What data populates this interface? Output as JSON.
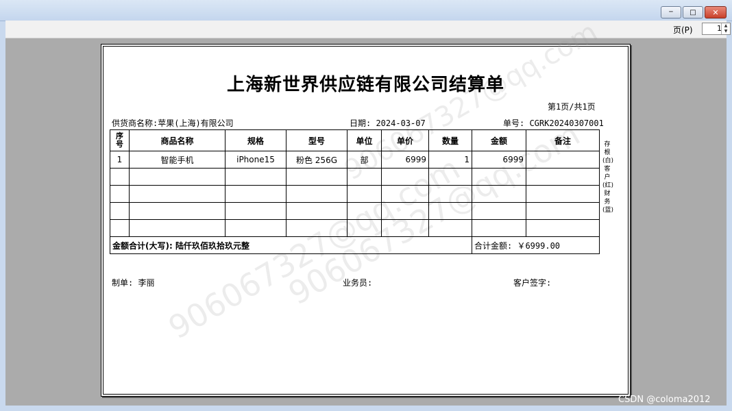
{
  "window": {
    "minimize": "─",
    "maximize": "□",
    "close": "✕"
  },
  "toolbar": {
    "page_label": "页(P)",
    "page_value": "1"
  },
  "doc": {
    "title": "上海新世界供应链有限公司结算单",
    "page_info": "第1页/共1页",
    "supplier": "供货商名称:苹果(上海)有限公司",
    "date": "日期: 2024-03-07",
    "order_no": "单号: CGRK20240307001",
    "headers": [
      "序号",
      "商品名称",
      "规格",
      "型号",
      "单位",
      "单价",
      "数量",
      "金额",
      "备注"
    ],
    "rows": [
      [
        "1",
        "智能手机",
        "iPhone15",
        "粉色 256G",
        "部",
        "6999",
        "1",
        "6999",
        ""
      ]
    ],
    "sum_words": "金额合计(大写): 陆仟玖佰玖拾玖元整",
    "sum_total": "合计金额: ￥6999.00",
    "maker": "制单: 李丽",
    "salesman": "业务员:",
    "customer_sign": "客户签字:",
    "side_text": "存根(白)客户(红)财务(蓝)",
    "watermark": "906067327@qq.com"
  },
  "footer": {
    "credit": "CSDN @coloma2012"
  }
}
